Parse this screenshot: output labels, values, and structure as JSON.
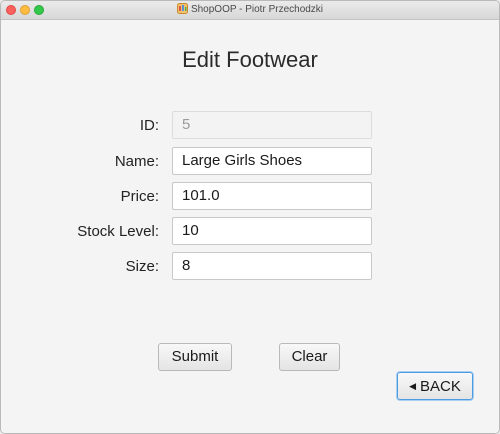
{
  "window": {
    "title": "ShopOOP - Piotr Przechodzki"
  },
  "form": {
    "heading": "Edit Footwear",
    "fields": [
      {
        "label": "ID:",
        "value": "5",
        "disabled": true
      },
      {
        "label": "Name:",
        "value": "Large Girls Shoes"
      },
      {
        "label": "Price:",
        "value": "101.0"
      },
      {
        "label": "Stock Level:",
        "value": "10"
      },
      {
        "label": "Size:",
        "value": "8"
      }
    ]
  },
  "buttons": {
    "submit": "Submit",
    "clear": "Clear",
    "back": "BACK"
  },
  "icons": {
    "back": "back-triangle-icon"
  }
}
